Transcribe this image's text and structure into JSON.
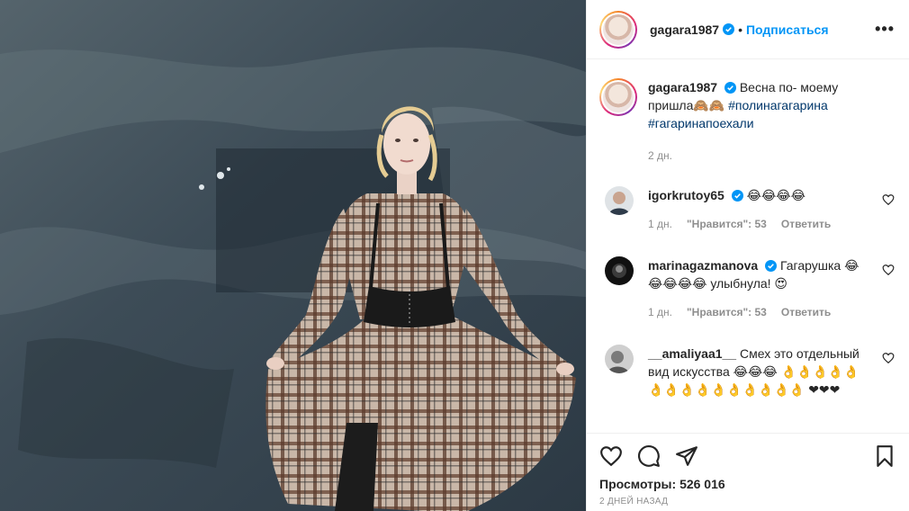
{
  "header": {
    "username": "gagara1987",
    "separator": "•",
    "follow_label": "Подписаться",
    "more_label": "•••"
  },
  "caption": {
    "username": "gagara1987",
    "text": "Весна по- моему пришла🙈🙈",
    "hashtags": [
      "#полинагагарина",
      "#гагаринапоехали"
    ],
    "time": "2 дн."
  },
  "comments": [
    {
      "username": "igorkrutoy65",
      "verified": true,
      "text": "😂😂😂😂",
      "time": "1 дн.",
      "likes": "\"Нравится\": 53",
      "reply": "Ответить"
    },
    {
      "username": "marinagazmanova",
      "verified": true,
      "text": "Гагарушка 😂😂😂😂😂 улыбнула! 😍",
      "time": "1 дн.",
      "likes": "\"Нравится\": 53",
      "reply": "Ответить"
    },
    {
      "username": "__amaliyaa1__",
      "verified": false,
      "text": "Смех это отдельный вид искусства 😂😂😂 👌👌👌👌👌👌👌👌👌👌👌👌👌👌👌 ❤❤❤"
    }
  ],
  "stats": {
    "views_label": "Просмотры:",
    "views_value": "526 016",
    "posted_ago": "2 ДНЕЙ НАЗАД"
  },
  "colors": {
    "accent": "#0095f6",
    "text": "#262626",
    "muted": "#8e8e8e",
    "hashtag": "#00376b"
  }
}
